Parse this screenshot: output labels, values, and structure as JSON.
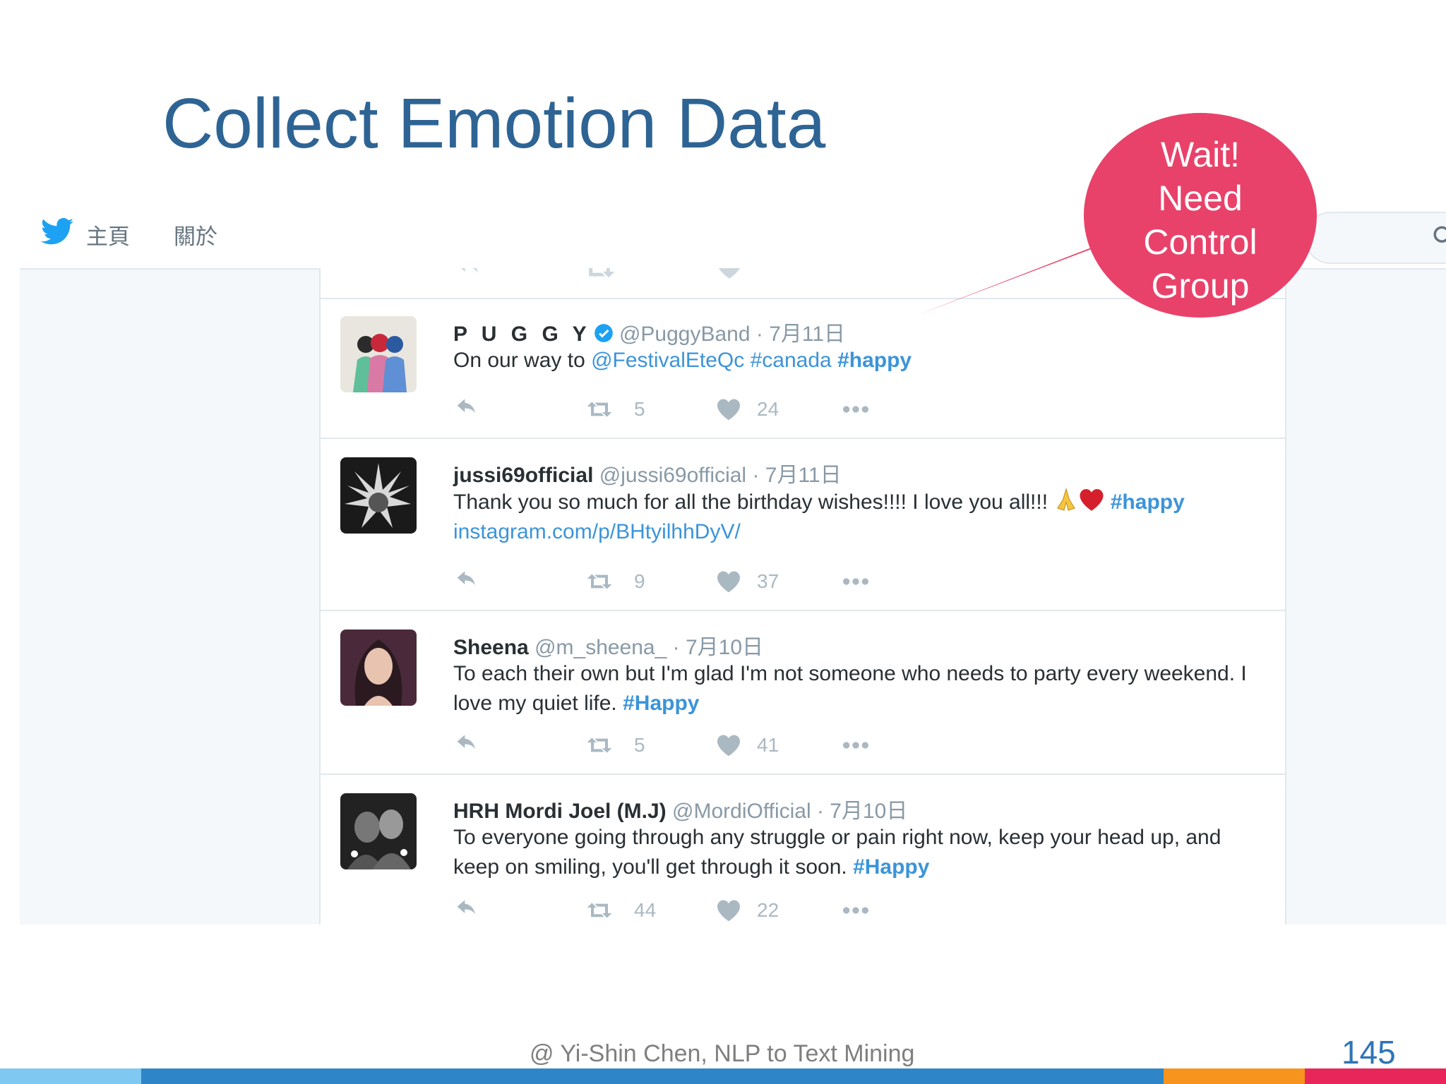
{
  "slide": {
    "title": "Collect Emotion Data",
    "callout": [
      "Wait!",
      "Need",
      "Control",
      "Group"
    ],
    "footer": "@ Yi-Shin Chen, NLP to Text Mining",
    "page_number": "145",
    "colors": {
      "title": "#2e6494",
      "callout": "#e8426a",
      "bar": [
        "#7ec8f2",
        "#2e86c8",
        "#f7941d",
        "#e8265a"
      ]
    }
  },
  "twitter": {
    "nav": {
      "home": "主頁",
      "about": "關於"
    },
    "icons": {
      "logo": "twitter-bird-icon",
      "search": "search-icon",
      "reply": "reply-icon",
      "retweet": "retweet-icon",
      "like": "heart-icon",
      "more": "more-icon"
    },
    "tweets": [
      {
        "name": "P U G G Y",
        "handle": "@PuggyBand",
        "date": "· 7月11日",
        "verified": true,
        "text_plain": "On our way to ",
        "mention": "@FestivalEteQc",
        "tag1": "#canada",
        "tag2": "#happy",
        "retweets": "5",
        "likes": "24"
      },
      {
        "name": "jussi69official",
        "handle": "@jussi69official",
        "date": "· 7月11日",
        "text_plain": "Thank you so much for all the birthday wishes!!!! I love you all!!! ",
        "tag": "#happy",
        "link": "instagram.com/p/BHtyilhhDyV/",
        "retweets": "9",
        "likes": "37"
      },
      {
        "name": "Sheena",
        "handle": "@m_sheena_",
        "date": "· 7月10日",
        "text_plain": "To each their own but I'm glad I'm not someone who needs to party every weekend. I love my quiet life. ",
        "tag": "#Happy",
        "retweets": "5",
        "likes": "41"
      },
      {
        "name": "HRH Mordi Joel (M.J)",
        "handle": "@MordiOfficial",
        "date": "· 7月10日",
        "text_plain": "To everyone going through any struggle or pain right now, keep your head up, and keep on smiling, you'll get through it soon. ",
        "tag": "#Happy",
        "retweets": "44",
        "likes": "22"
      }
    ]
  }
}
